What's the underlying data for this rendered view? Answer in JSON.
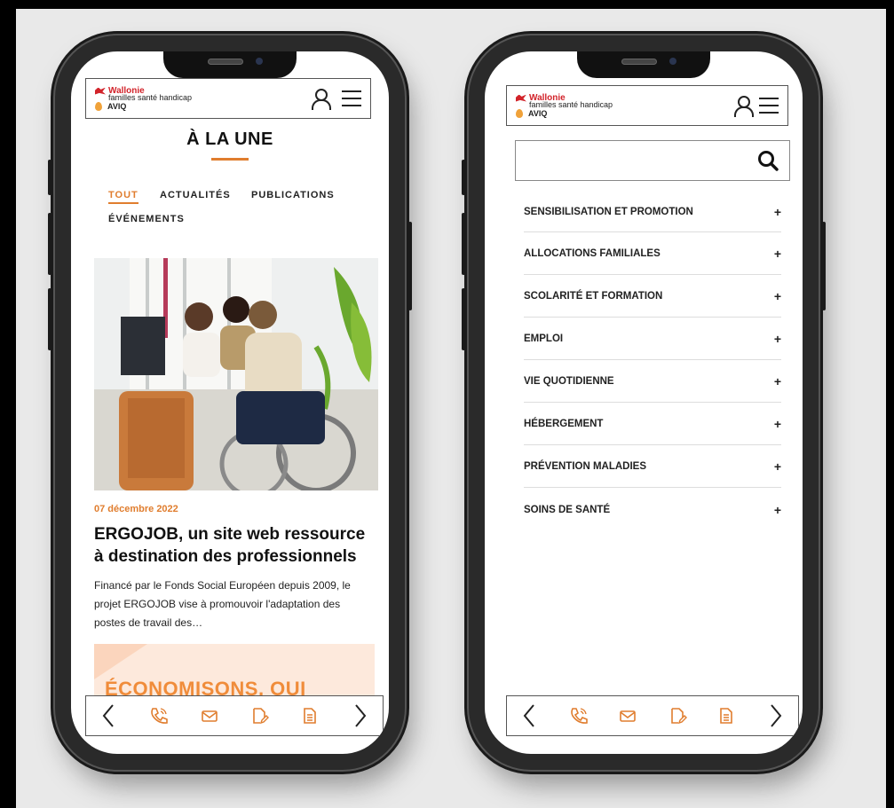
{
  "left_phone": {
    "header": {
      "logo_line1": "Wallonie",
      "logo_line2": "familles santé handicap",
      "logo_line3": "AVIQ"
    },
    "section_title": "À LA UNE",
    "tabs": [
      "TOUT",
      "ACTUALITÉS",
      "PUBLICATIONS",
      "ÉVÉNEMENTS"
    ],
    "active_tab": "TOUT",
    "article": {
      "date": "07 décembre 2022",
      "headline_line1": "ERGOJOB, un site web ressource",
      "headline_line2": "à destination des professionnels",
      "excerpt_line1": "Financé par le Fonds Social Européen depuis 2009, le",
      "excerpt_line2": "projet ERGOJOB vise à promouvoir l'adaptation des",
      "excerpt_line3": "postes de travail des…"
    },
    "promo_text": "ÉCONOMISONS, OUI"
  },
  "right_phone": {
    "header": {
      "logo_line1": "Wallonie",
      "logo_line2": "familles santé handicap",
      "logo_line3": "AVIQ"
    },
    "search": {
      "placeholder": "",
      "icon": "search-icon"
    },
    "menu_items": [
      "SENSIBILISATION ET PROMOTION",
      "ALLOCATIONS FAMILIALES",
      "SCOLARITÉ ET FORMATION",
      "EMPLOI",
      "VIE QUOTIDIENNE",
      "HÉBERGEMENT",
      "PRÉVENTION MALADIES",
      "SOINS DE SANTÉ"
    ],
    "expand_symbol": "+"
  },
  "bottom_bar": {
    "icons": [
      "chevron-left-icon",
      "phone-icon",
      "mail-icon",
      "document-edit-icon",
      "document-icon",
      "chevron-right-icon"
    ],
    "prev": "‹",
    "next": "›"
  },
  "colors": {
    "accent": "#e07d2e",
    "brand_red": "#d2232a",
    "background": "#e9e9e9"
  }
}
